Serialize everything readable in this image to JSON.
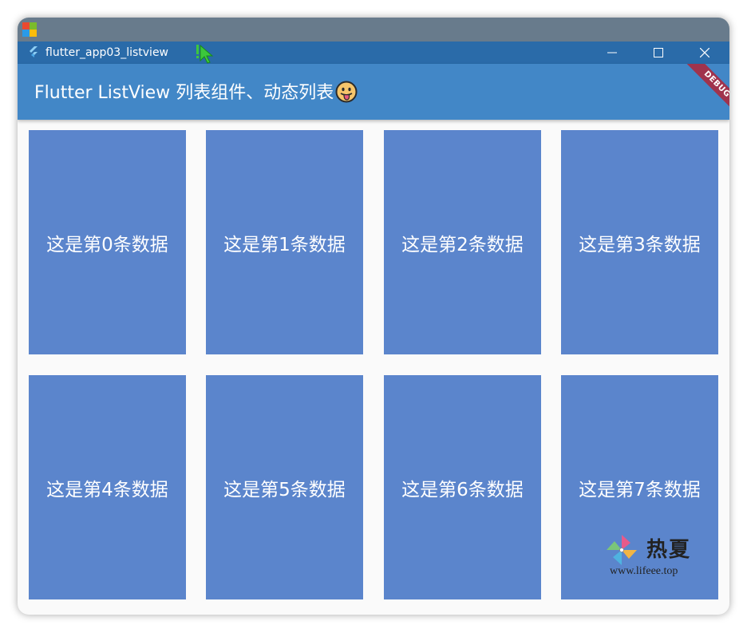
{
  "window": {
    "title": "flutter_app03_listview"
  },
  "appbar": {
    "title": "Flutter ListView 列表组件、动态列表",
    "debug_label": "DEBUG"
  },
  "grid": {
    "items": [
      {
        "label": "这是第0条数据"
      },
      {
        "label": "这是第1条数据"
      },
      {
        "label": "这是第2条数据"
      },
      {
        "label": "这是第3条数据"
      },
      {
        "label": "这是第4条数据"
      },
      {
        "label": "这是第5条数据"
      },
      {
        "label": "这是第6条数据"
      },
      {
        "label": "这是第7条数据"
      }
    ]
  },
  "watermark": {
    "brand": "热夏",
    "url": "www.lifeee.top"
  },
  "colors": {
    "titlebar": "#2a6ba9",
    "appbar": "#4287c7",
    "tile": "#5b85cc",
    "background": "#fafafa",
    "debug_ribbon": "#a0334d"
  },
  "icons": [
    "windows-logo-icon",
    "flutter-icon",
    "cursor-icon",
    "minimize-icon",
    "maximize-icon",
    "close-icon",
    "grinning-face-tongue-icon",
    "pinwheel-icon"
  ]
}
